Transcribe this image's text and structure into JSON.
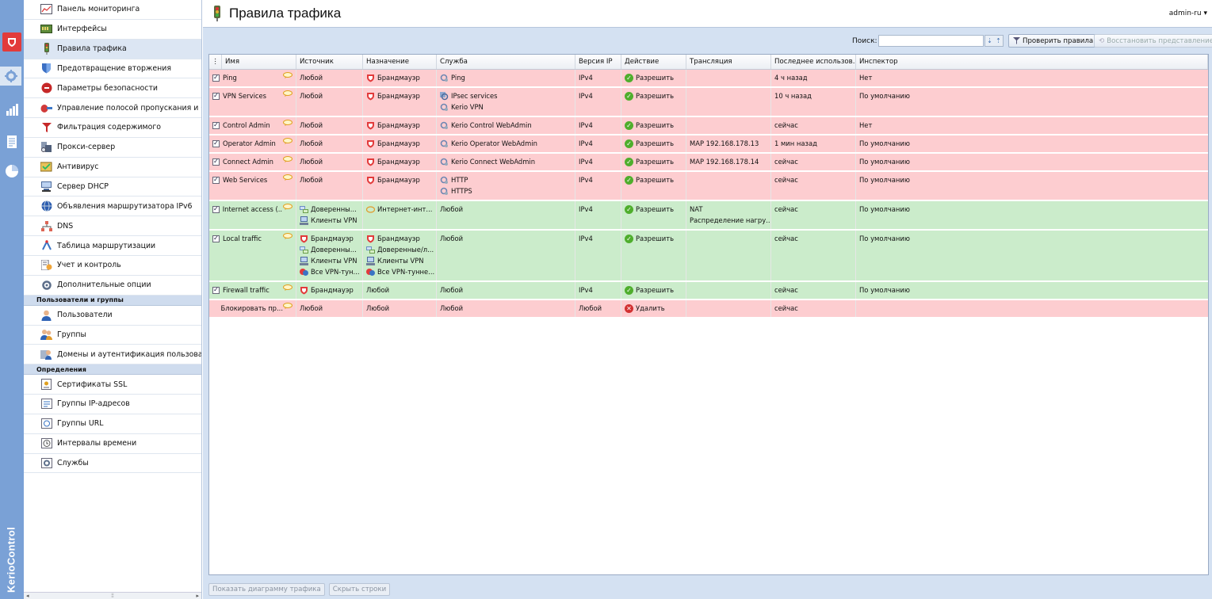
{
  "app": {
    "brand": "KerioControl",
    "user": "admin-ru"
  },
  "rail": {
    "items": [
      "shield-icon",
      "gear-icon",
      "stats-icon",
      "logs-icon",
      "pie-icon"
    ]
  },
  "nav": {
    "items": [
      {
        "label": "Панель мониторинга",
        "icon": "dashboard-icon"
      },
      {
        "label": "Интерфейсы",
        "icon": "interfaces-icon"
      },
      {
        "label": "Правила трафика",
        "icon": "traffic-icon",
        "selected": true
      },
      {
        "label": "Предотвращение вторжения",
        "icon": "ips-icon"
      },
      {
        "label": "Параметры безопасности",
        "icon": "security-icon"
      },
      {
        "label": "Управление полосой пропускания и Qo",
        "icon": "bandwidth-icon"
      },
      {
        "label": "Фильтрация содержимого",
        "icon": "filter-icon"
      },
      {
        "label": "Прокси-сервер",
        "icon": "proxy-icon"
      },
      {
        "label": "Антивирус",
        "icon": "antivirus-icon"
      },
      {
        "label": "Сервер DHCP",
        "icon": "dhcp-icon"
      },
      {
        "label": "Объявления маршрутизатора IPv6",
        "icon": "ipv6-icon"
      },
      {
        "label": "DNS",
        "icon": "dns-icon"
      },
      {
        "label": "Таблица маршрутизации",
        "icon": "routing-icon"
      },
      {
        "label": "Учет и контроль",
        "icon": "accounting-icon"
      },
      {
        "label": "Дополнительные опции",
        "icon": "advanced-icon"
      }
    ],
    "section_users": "Пользователи и группы",
    "users_items": [
      {
        "label": "Пользователи",
        "icon": "user-icon"
      },
      {
        "label": "Группы",
        "icon": "group-icon"
      },
      {
        "label": "Домены и аутентификация пользовател",
        "icon": "domain-icon"
      }
    ],
    "section_defs": "Определения",
    "defs_items": [
      {
        "label": "Сертификаты SSL",
        "icon": "certificate-icon"
      },
      {
        "label": "Группы IP-адресов",
        "icon": "ip-group-icon"
      },
      {
        "label": "Группы URL",
        "icon": "url-group-icon"
      },
      {
        "label": "Интервалы времени",
        "icon": "time-icon"
      },
      {
        "label": "Службы",
        "icon": "services-icon"
      }
    ]
  },
  "page": {
    "title": "Правила трафика"
  },
  "toolbar": {
    "search_label": "Поиск:",
    "search_value": "",
    "check_rules": "Проверить правила",
    "restore_view": "Восстановить представление"
  },
  "grid": {
    "columns": [
      "Имя",
      "Источник",
      "Назначение",
      "Служба",
      "Версия IP",
      "Действие",
      "Трансляция",
      "Последнее использов...",
      "Инспектор"
    ],
    "rows": [
      {
        "color": "red",
        "checked": true,
        "name": "Ping",
        "source": [
          [
            "any",
            "Любой"
          ]
        ],
        "dest": [
          [
            "fw",
            "Брандмауэр"
          ]
        ],
        "service": [
          [
            "svc",
            "Ping"
          ]
        ],
        "ip": "IPv4",
        "action": "Разрешить",
        "translation": [],
        "last": "4 ч назад",
        "inspector": "Нет"
      },
      {
        "color": "red",
        "checked": true,
        "name": "VPN Services",
        "source": [
          [
            "any",
            "Любой"
          ]
        ],
        "dest": [
          [
            "fw",
            "Брандмауэр"
          ]
        ],
        "service": [
          [
            "svcg",
            "IPsec services"
          ],
          [
            "svc",
            "Kerio VPN"
          ]
        ],
        "ip": "IPv4",
        "action": "Разрешить",
        "translation": [],
        "last": "10 ч назад",
        "inspector": "По умолчанию"
      },
      {
        "color": "red",
        "checked": true,
        "name": "Control Admin",
        "source": [
          [
            "any",
            "Любой"
          ]
        ],
        "dest": [
          [
            "fw",
            "Брандмауэр"
          ]
        ],
        "service": [
          [
            "svc",
            "Kerio Control WebAdmin"
          ]
        ],
        "ip": "IPv4",
        "action": "Разрешить",
        "translation": [],
        "last": "сейчас",
        "inspector": "Нет"
      },
      {
        "color": "red",
        "checked": true,
        "name": "Operator Admin",
        "source": [
          [
            "any",
            "Любой"
          ]
        ],
        "dest": [
          [
            "fw",
            "Брандмауэр"
          ]
        ],
        "service": [
          [
            "svc",
            "Kerio Operator WebAdmin"
          ]
        ],
        "ip": "IPv4",
        "action": "Разрешить",
        "translation": [
          "MAP 192.168.178.13"
        ],
        "last": "1 мин назад",
        "inspector": "По умолчанию"
      },
      {
        "color": "red",
        "checked": true,
        "name": "Connect Admin",
        "source": [
          [
            "any",
            "Любой"
          ]
        ],
        "dest": [
          [
            "fw",
            "Брандмауэр"
          ]
        ],
        "service": [
          [
            "svc",
            "Kerio Connect WebAdmin"
          ]
        ],
        "ip": "IPv4",
        "action": "Разрешить",
        "translation": [
          "MAP 192.168.178.14"
        ],
        "last": "сейчас",
        "inspector": "По умолчанию"
      },
      {
        "color": "red",
        "checked": true,
        "name": "Web Services",
        "source": [
          [
            "any",
            "Любой"
          ]
        ],
        "dest": [
          [
            "fw",
            "Брандмауэр"
          ]
        ],
        "service": [
          [
            "svc",
            "HTTP"
          ],
          [
            "svc",
            "HTTPS"
          ]
        ],
        "ip": "IPv4",
        "action": "Разрешить",
        "translation": [],
        "last": "сейчас",
        "inspector": "По умолчанию"
      },
      {
        "color": "green",
        "checked": true,
        "name": "Internet access (...",
        "source": [
          [
            "net",
            "Доверенны..."
          ],
          [
            "vpn",
            "Клиенты VPN"
          ]
        ],
        "dest": [
          [
            "inet",
            "Интернет-инт..."
          ]
        ],
        "service": [
          [
            "any",
            "Любой"
          ]
        ],
        "ip": "IPv4",
        "action": "Разрешить",
        "translation": [
          "NAT",
          "Распределение нагру..."
        ],
        "last": "сейчас",
        "inspector": "По умолчанию"
      },
      {
        "color": "green",
        "checked": true,
        "name": "Local traffic",
        "source": [
          [
            "fw",
            "Брандмауэр"
          ],
          [
            "net",
            "Доверенны..."
          ],
          [
            "vpn",
            "Клиенты VPN"
          ],
          [
            "vpnt",
            "Все VPN-тун..."
          ]
        ],
        "dest": [
          [
            "fw",
            "Брандмауэр"
          ],
          [
            "net",
            "Доверенные/л..."
          ],
          [
            "vpn",
            "Клиенты VPN"
          ],
          [
            "vpnt",
            "Все VPN-тунне..."
          ]
        ],
        "service": [
          [
            "any",
            "Любой"
          ]
        ],
        "ip": "IPv4",
        "action": "Разрешить",
        "translation": [],
        "last": "сейчас",
        "inspector": "По умолчанию"
      },
      {
        "color": "green",
        "checked": true,
        "name": "Firewall traffic",
        "source": [
          [
            "fw",
            "Брандмауэр"
          ]
        ],
        "dest": [
          [
            "any",
            "Любой"
          ]
        ],
        "service": [
          [
            "any",
            "Любой"
          ]
        ],
        "ip": "IPv4",
        "action": "Разрешить",
        "translation": [],
        "last": "сейчас",
        "inspector": "По умолчанию"
      },
      {
        "color": "red",
        "checked": false,
        "name": "Блокировать пр...",
        "source": [
          [
            "any",
            "Любой"
          ]
        ],
        "dest": [
          [
            "any",
            "Любой"
          ]
        ],
        "service": [
          [
            "any",
            "Любой"
          ]
        ],
        "ip": "Любой",
        "action": "Удалить",
        "deny": true,
        "translation": [],
        "last": "сейчас",
        "inspector": ""
      }
    ]
  },
  "bottom": {
    "show_diagram": "Показать диаграмму трафика",
    "hide_rows": "Скрыть строки"
  }
}
